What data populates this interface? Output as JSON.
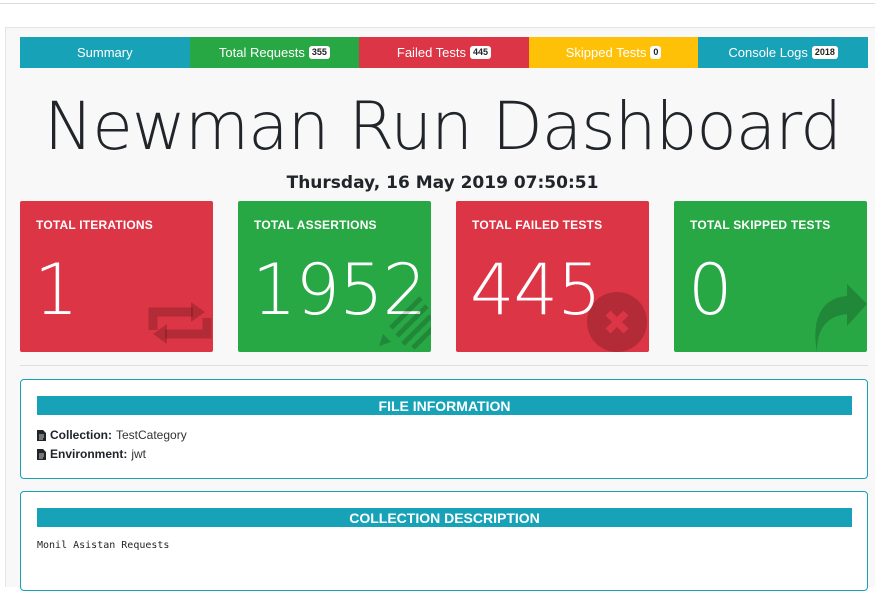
{
  "tabs": [
    {
      "label": "Summary",
      "badge": null
    },
    {
      "label": "Total Requests",
      "badge": "355"
    },
    {
      "label": "Failed Tests",
      "badge": "445"
    },
    {
      "label": "Skipped Tests",
      "badge": "0"
    },
    {
      "label": "Console Logs",
      "badge": "2018"
    }
  ],
  "page": {
    "title": "Newman Run Dashboard",
    "timestamp": "Thursday, 16 May 2019 07:50:51"
  },
  "cards": [
    {
      "label": "TOTAL ITERATIONS",
      "value": "1",
      "icon": "sync-icon"
    },
    {
      "label": "TOTAL ASSERTIONS",
      "value": "1952",
      "icon": "pen-lines-icon"
    },
    {
      "label": "TOTAL FAILED TESTS",
      "value": "445",
      "icon": "x-circle-icon"
    },
    {
      "label": "TOTAL SKIPPED TESTS",
      "value": "0",
      "icon": "share-arrow-icon"
    }
  ],
  "file_info": {
    "heading": "FILE INFORMATION",
    "collection_label": "Collection:",
    "collection_value": "TestCategory",
    "environment_label": "Environment:",
    "environment_value": "jwt"
  },
  "collection_description": {
    "heading": "COLLECTION DESCRIPTION",
    "text": "Monil Asistan Requests"
  },
  "colors": {
    "info": "#17a2b8",
    "success": "#28a745",
    "danger": "#dc3545",
    "warning": "#ffc107"
  }
}
